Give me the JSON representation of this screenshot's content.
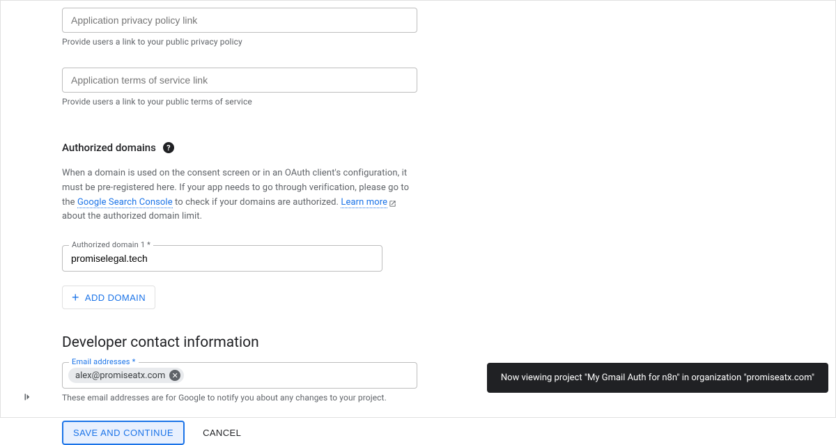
{
  "fields": {
    "privacy_policy": {
      "placeholder": "Application privacy policy link",
      "helper": "Provide users a link to your public privacy policy"
    },
    "terms_of_service": {
      "placeholder": "Application terms of service link",
      "helper": "Provide users a link to your public terms of service"
    }
  },
  "authorized_domains": {
    "title": "Authorized domains",
    "desc_pre": "When a domain is used on the consent screen or in an OAuth client's configuration, it must be pre-registered here. If your app needs to go through verification, please go to the ",
    "link1": "Google Search Console",
    "desc_mid": " to check if your domains are authorized. ",
    "link2": "Learn more",
    "desc_post": " about the authorized domain limit.",
    "field_label": "Authorized domain 1 *",
    "field_value": "promiselegal.tech",
    "add_button": "ADD DOMAIN"
  },
  "developer_contact": {
    "title": "Developer contact information",
    "field_label": "Email addresses *",
    "chip_email": "alex@promiseatx.com",
    "helper": "These email addresses are for Google to notify you about any changes to your project."
  },
  "buttons": {
    "save": "SAVE AND CONTINUE",
    "cancel": "CANCEL"
  },
  "toast": "Now viewing project \"My Gmail Auth for n8n\" in organization \"promiseatx.com\""
}
